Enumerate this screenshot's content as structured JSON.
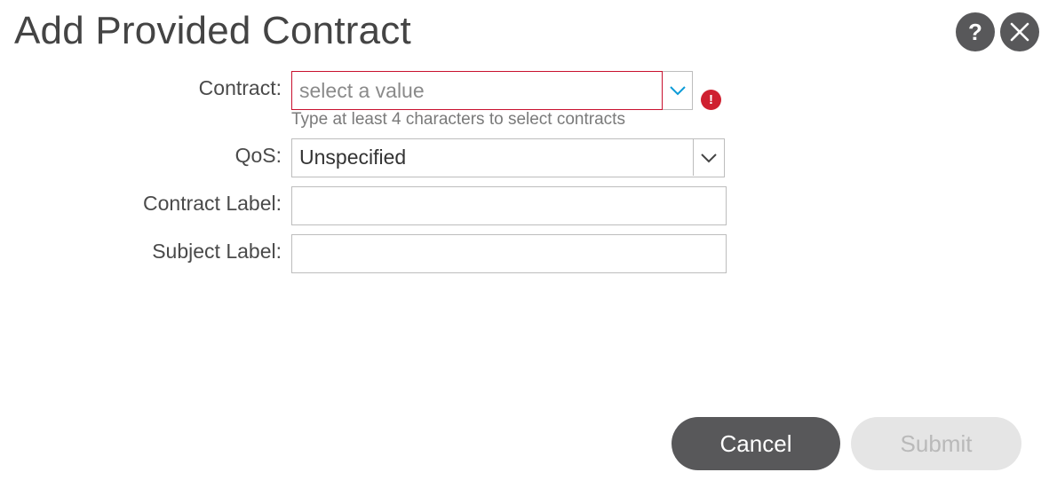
{
  "dialog": {
    "title": "Add Provided Contract"
  },
  "header_actions": {
    "help_glyph": "?",
    "help_icon": "help-icon",
    "close_icon": "close-icon"
  },
  "form": {
    "contract": {
      "label": "Contract:",
      "value": "",
      "placeholder": "select a value",
      "hint": "Type at least 4 characters to select contracts",
      "error_glyph": "!",
      "error_color": "#cf2030",
      "dropdown_icon": "chevron-down-icon"
    },
    "qos": {
      "label": "QoS:",
      "selected": "Unspecified",
      "dropdown_icon": "chevron-down-icon"
    },
    "contract_label": {
      "label": "Contract Label:",
      "value": ""
    },
    "subject_label": {
      "label": "Subject Label:",
      "value": ""
    }
  },
  "footer": {
    "cancel_label": "Cancel",
    "submit_label": "Submit",
    "submit_disabled": true
  },
  "colors": {
    "error_border": "#c8102e",
    "dark_button": "#58585a",
    "disabled_button": "#e5e5e5",
    "chevron_accent": "#0d9bd7"
  }
}
